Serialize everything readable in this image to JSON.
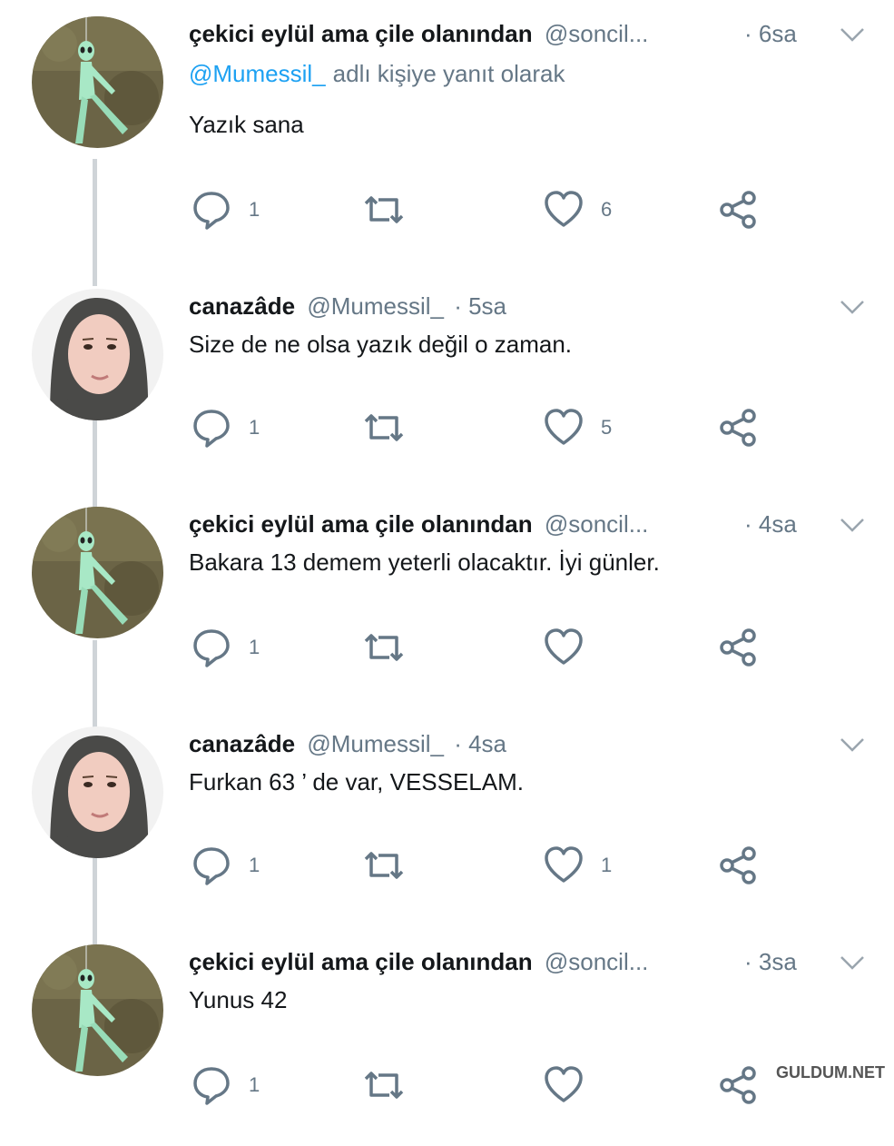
{
  "tweets": [
    {
      "name": "çekici eylül ama çile olanından",
      "handle": "@soncil...",
      "time": "· 6sa",
      "reply_mention": "@Mumessil_",
      "reply_suffix": "adlı kişiye yanıt olarak",
      "text": "Yazık sana",
      "reply_count": "1",
      "like_count": "6",
      "avatar": "alien-avatar"
    },
    {
      "name": "canazâde",
      "handle": "@Mumessil_",
      "time": "· 5sa",
      "text": "Size de ne olsa yazık değil o zaman.",
      "reply_count": "1",
      "like_count": "5",
      "avatar": "woman-avatar"
    },
    {
      "name": "çekici eylül ama çile olanından",
      "handle": "@soncil...",
      "time": "· 4sa",
      "text": "Bakara 13 demem yeterli olacaktır. İyi günler.",
      "reply_count": "1",
      "like_count": "",
      "avatar": "alien-avatar"
    },
    {
      "name": "canazâde",
      "handle": "@Mumessil_",
      "time": "· 4sa",
      "text": "Furkan 63 ’ de var, VESSELAM.",
      "reply_count": "1",
      "like_count": "1",
      "avatar": "woman-avatar"
    },
    {
      "name": "çekici eylül ama çile olanından",
      "handle": "@soncil...",
      "time": "· 3sa",
      "text": "Yunus 42",
      "reply_count": "1",
      "like_count": "",
      "avatar": "alien-avatar"
    }
  ],
  "icons": {
    "reply": "reply-icon",
    "retweet": "retweet-icon",
    "like": "heart-icon",
    "share": "share-icon",
    "more": "chevron-down-icon"
  },
  "colors": {
    "text": "#14171a",
    "secondary": "#657786",
    "link": "#1da1f2",
    "thread_line": "#cfd4d8"
  },
  "watermark": "GULDUM.NET"
}
